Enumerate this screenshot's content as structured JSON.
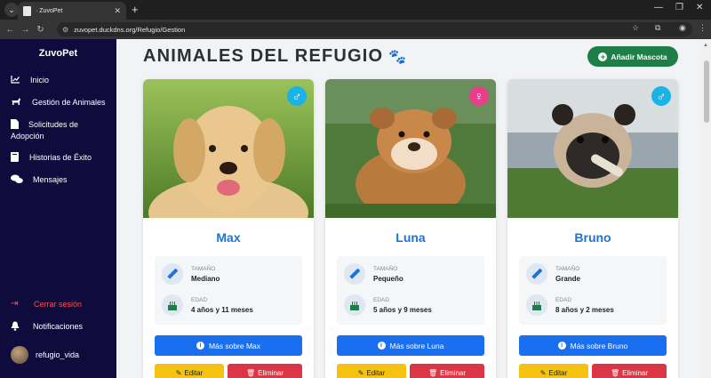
{
  "browser": {
    "tab_title": "· ZuvoPet",
    "url": "zuvopet.duckdns.org/Refugio/Gestion"
  },
  "sidebar": {
    "brand": "ZuvoPet",
    "items": [
      {
        "label": "Inicio",
        "icon": "chart-line-icon"
      },
      {
        "label": "Gestión de Animales",
        "icon": "dog-icon"
      },
      {
        "label": "Solicitudes de Adopción",
        "icon": "file-icon"
      },
      {
        "label": "Historias de Éxito",
        "icon": "book-icon"
      },
      {
        "label": "Mensajes",
        "icon": "comments-icon"
      }
    ],
    "logout": "Cerrar sesión",
    "notifications": "Notificaciones",
    "username": "refugio_vida"
  },
  "main": {
    "title": "ANIMALES DEL REFUGIO",
    "add_button": "Añadir Mascota",
    "size_label": "TAMAÑO",
    "age_label": "EDAD",
    "edit_label": "Editar",
    "delete_label": "Eliminar",
    "pets": [
      {
        "name": "Max",
        "gender": "male",
        "size": "Mediano",
        "age": "4 años y 11 meses",
        "more": "Más sobre Max"
      },
      {
        "name": "Luna",
        "gender": "female",
        "size": "Pequeño",
        "age": "5 años y 9 meses",
        "more": "Más sobre Luna"
      },
      {
        "name": "Bruno",
        "gender": "male",
        "size": "Grande",
        "age": "8 años y 2 meses",
        "more": "Más sobre Bruno"
      }
    ]
  },
  "colors": {
    "sidebar_bg": "#0f0c3d",
    "accent_blue": "#1a73d9",
    "add_green": "#1e7e48",
    "edit_yellow": "#f5c211",
    "delete_red": "#dc3545",
    "male_badge": "#1ab3e6",
    "female_badge": "#e83e8c"
  }
}
